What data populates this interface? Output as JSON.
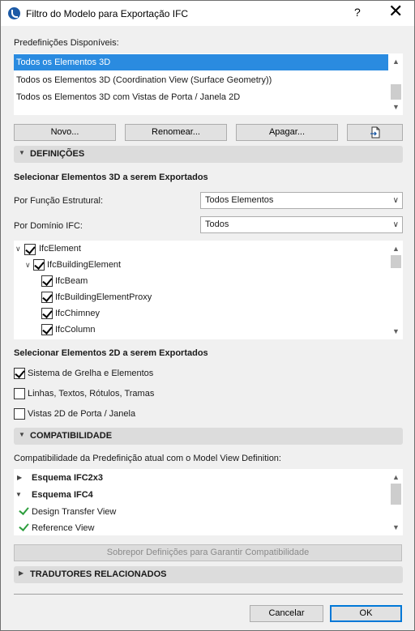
{
  "window": {
    "title": "Filtro do Modelo para Exportação IFC",
    "help": "?",
    "close": "✕"
  },
  "presets": {
    "label": "Predefinições Disponíveis:",
    "items": [
      "Todos os Elementos 3D",
      "Todos os Elementos 3D (Coordination View (Surface Geometry))",
      "Todos os Elementos 3D com Vistas de Porta / Janela 2D"
    ],
    "selected_index": 0
  },
  "buttons": {
    "new": "Novo...",
    "rename": "Renomear...",
    "delete": "Apagar...",
    "ok": "OK",
    "cancel": "Cancelar",
    "override": "Sobrepor Definições para Garantir Compatibilidade"
  },
  "definitions": {
    "header": "DEFINIÇÕES",
    "select3d_title": "Selecionar Elementos 3D a serem Exportados",
    "structural_label": "Por Função Estrutural:",
    "structural_value": "Todos Elementos",
    "domain_label": "Por Domínio IFC:",
    "domain_value": "Todos",
    "tree": [
      {
        "label": "IfcElement",
        "checked": true
      },
      {
        "label": "IfcBuildingElement",
        "checked": true
      },
      {
        "label": "IfcBeam",
        "checked": true
      },
      {
        "label": "IfcBuildingElementProxy",
        "checked": true
      },
      {
        "label": "IfcChimney",
        "checked": true
      },
      {
        "label": "IfcColumn",
        "checked": true
      }
    ],
    "select2d_title": "Selecionar Elementos 2D a serem Exportados",
    "opts2d": [
      {
        "label": "Sistema de Grelha e Elementos",
        "checked": true
      },
      {
        "label": "Linhas, Textos, Rótulos, Tramas",
        "checked": false
      },
      {
        "label": "Vistas 2D de Porta / Janela",
        "checked": false
      }
    ]
  },
  "compat": {
    "header": "COMPATIBILIDADE",
    "desc": "Compatibilidade da Predefinição atual com o Model View Definition:",
    "items": [
      {
        "label": "Esquema IFC2x3"
      },
      {
        "label": "Esquema IFC4"
      },
      {
        "label": "Design Transfer View"
      },
      {
        "label": "Reference View"
      }
    ]
  },
  "translators": {
    "header": "TRADUTORES RELACIONADOS"
  },
  "colors": {
    "selection": "#2a8be0",
    "check_green": "#2e9e3e",
    "section_bg": "#dcdcdc"
  }
}
